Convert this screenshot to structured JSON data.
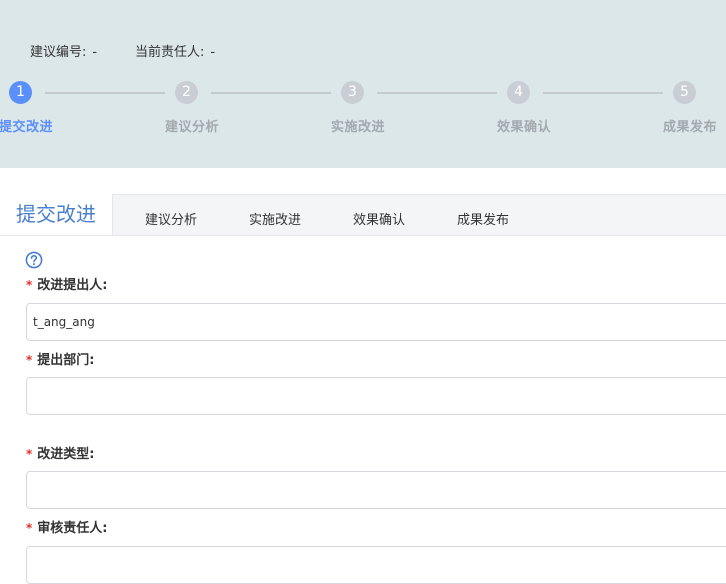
{
  "header": {
    "suggestion_no_label": "建议编号:",
    "suggestion_no_value": "-",
    "current_owner_label": "当前责任人:",
    "current_owner_value": "-"
  },
  "steps": [
    {
      "number": "1",
      "label": "提交改进",
      "active": true
    },
    {
      "number": "2",
      "label": "建议分析",
      "active": false
    },
    {
      "number": "3",
      "label": "实施改进",
      "active": false
    },
    {
      "number": "4",
      "label": "效果确认",
      "active": false
    },
    {
      "number": "5",
      "label": "成果发布",
      "active": false
    }
  ],
  "tabs": [
    {
      "label": "提交改进",
      "active": true
    },
    {
      "label": "建议分析",
      "active": false
    },
    {
      "label": "实施改进",
      "active": false
    },
    {
      "label": "效果确认",
      "active": false
    },
    {
      "label": "成果发布",
      "active": false
    }
  ],
  "form": {
    "required_mark": "*",
    "fields": [
      {
        "label": "改进提出人:",
        "value": "t_ang_ang",
        "placeholder": ""
      },
      {
        "label": "提出部门:",
        "value": "",
        "placeholder": ""
      },
      {
        "label": "改进类型:",
        "value": "",
        "placeholder": ""
      },
      {
        "label": "审核责任人:",
        "value": "",
        "placeholder": ""
      }
    ]
  },
  "colors": {
    "accent": "#5b8ff9",
    "header_bg": "#dce7ea",
    "required": "#e0322a"
  },
  "icons": {
    "help": "question-circle-icon"
  }
}
